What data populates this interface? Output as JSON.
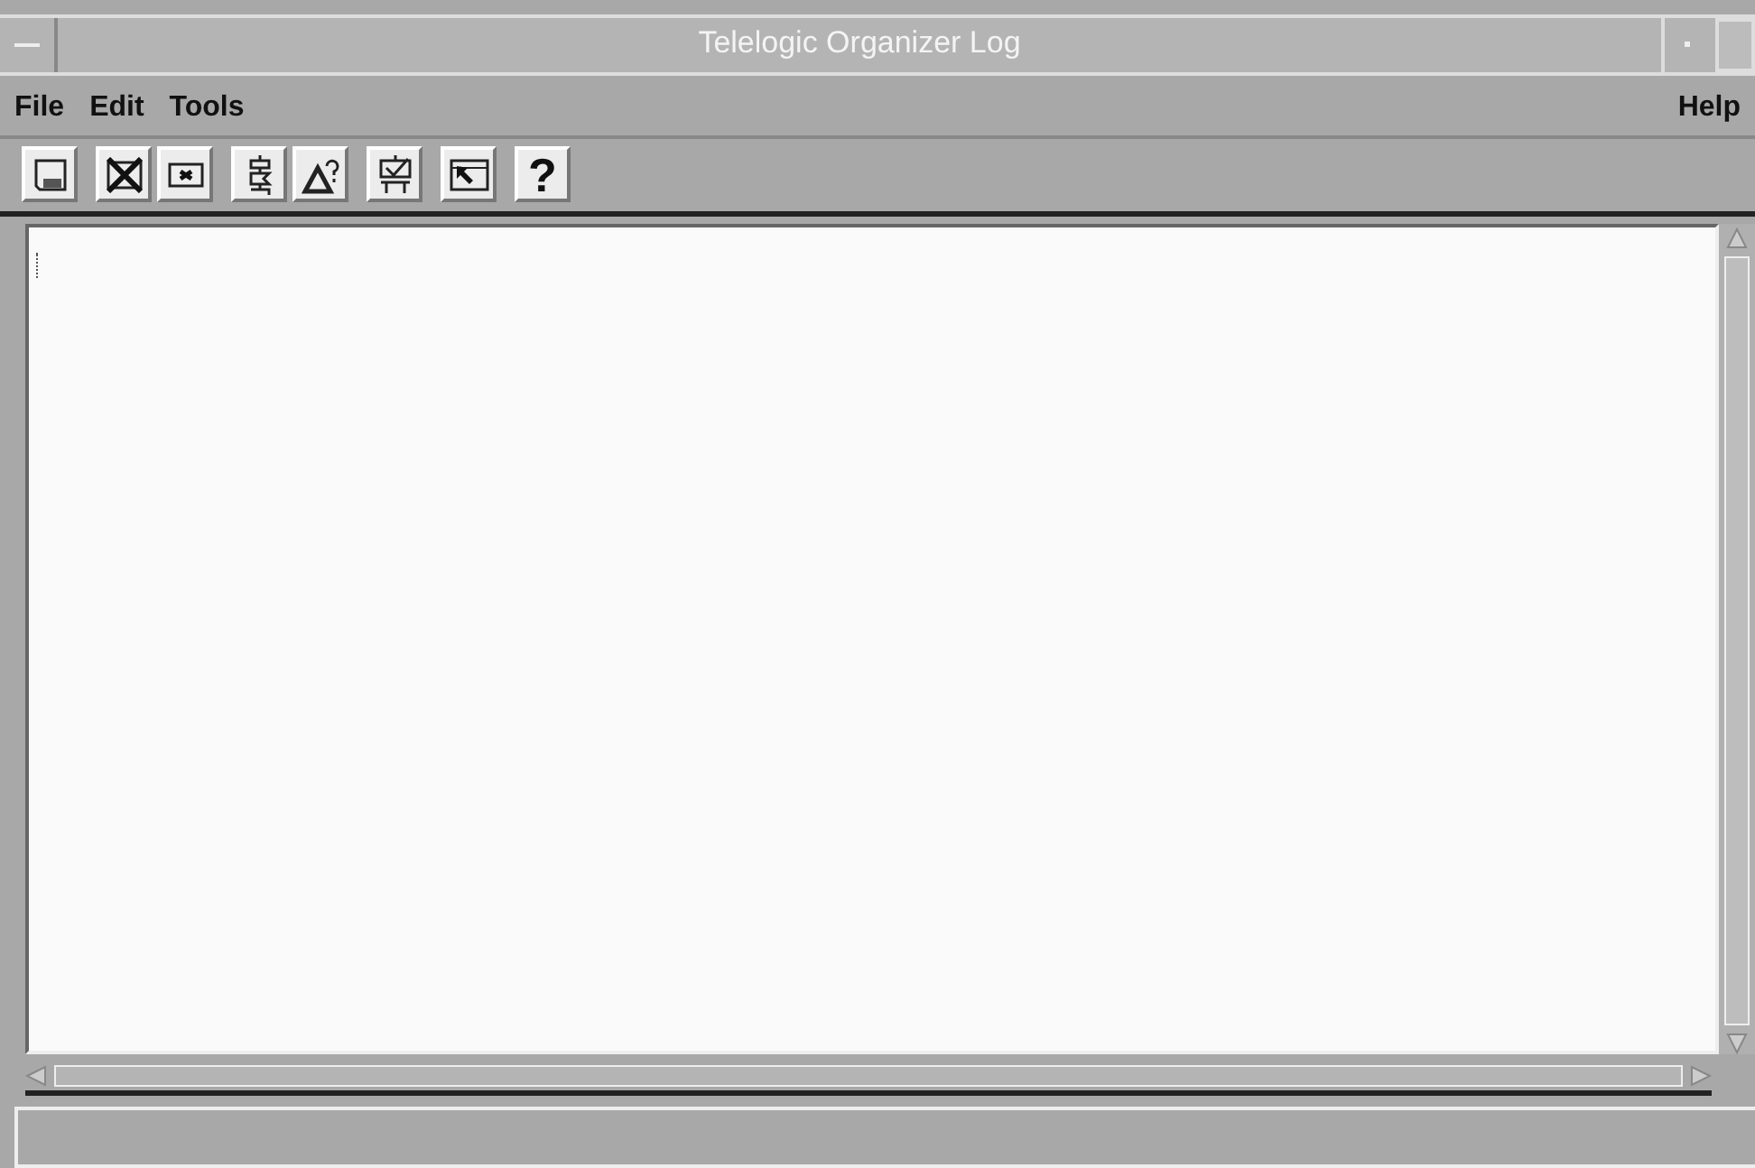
{
  "window": {
    "title": "Telelogic Organizer Log"
  },
  "menu_left": [
    "File",
    "Edit",
    "Tools"
  ],
  "menu_right": [
    "Help"
  ],
  "toolbar": [
    [
      {
        "kind": "save"
      }
    ],
    [
      {
        "kind": "delete"
      },
      {
        "kind": "close"
      }
    ],
    [
      {
        "kind": "flow"
      },
      {
        "kind": "triangle"
      }
    ],
    [
      {
        "kind": "check"
      }
    ],
    [
      {
        "kind": "arrow"
      }
    ],
    [
      {
        "kind": "help",
        "label": "?"
      }
    ]
  ]
}
